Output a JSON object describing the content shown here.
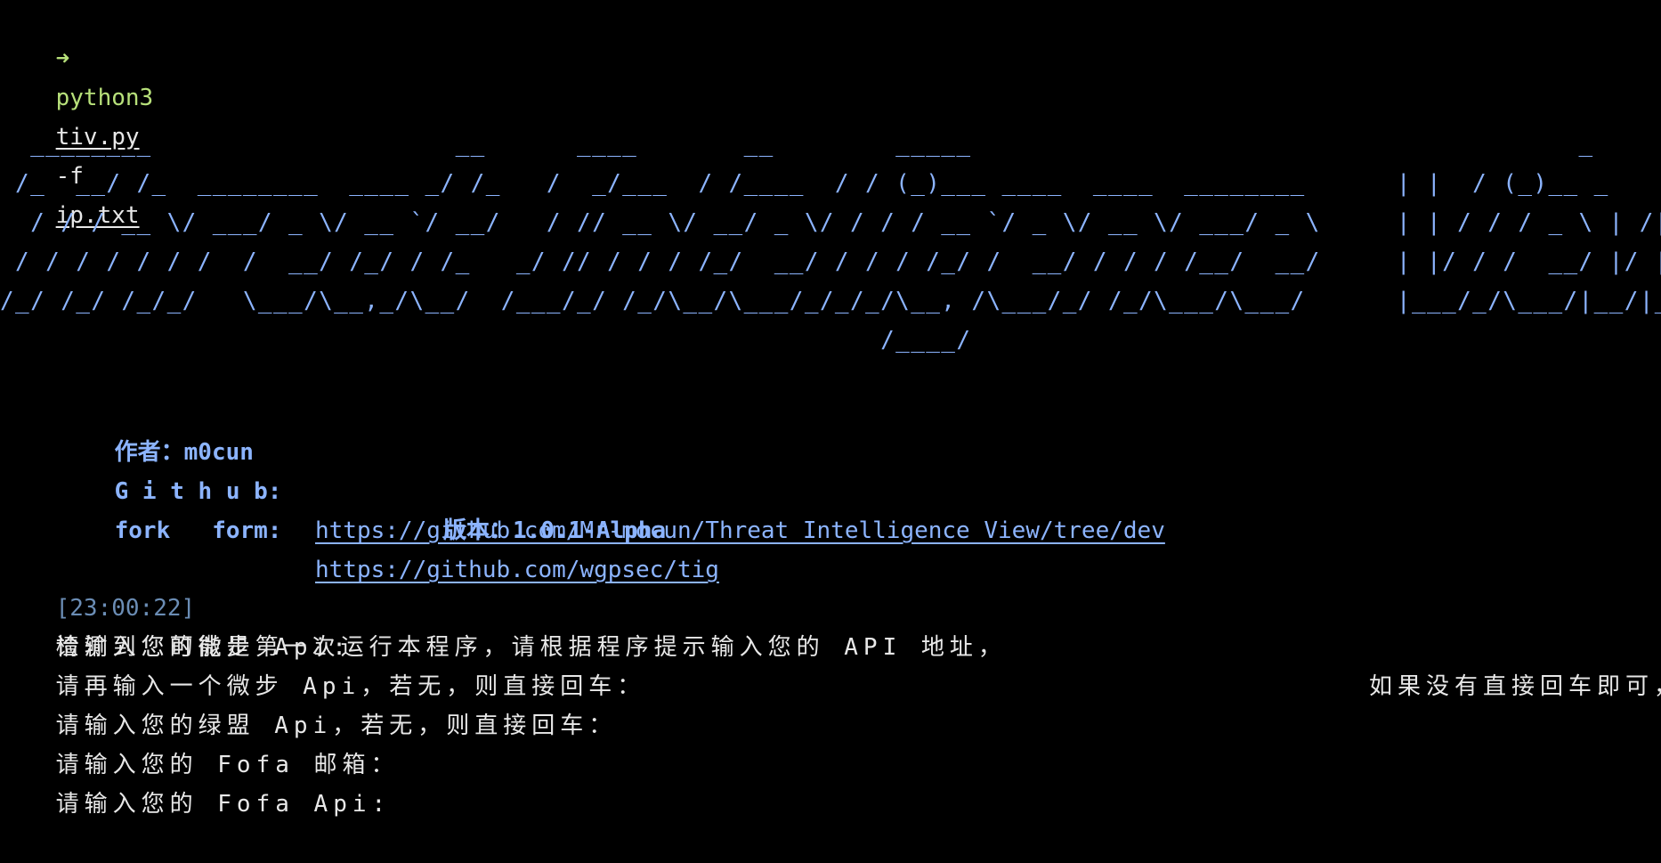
{
  "shell": {
    "arrow": "➜",
    "command": "python3",
    "script": "tiv.py",
    "flag": "-f",
    "input_file": "ip.txt"
  },
  "banner": {
    "ascii_art": "  ________                    __      ____       __        _____                                        _     ___\n /_  __/ /_  ________  ____ _/ /_   /  _/___  / /____  / / (_)___ ____  ____  ________      | |  / (_)__ _      __\n  / / / __ \\/ ___/ _ \\/ __ `/ __/   / // __ \\/ __/ _ \\/ / / / __ `/ _ \\/ __ \\/ ___/ _ \\     | | / / / _ \\ | /| / /\n / / / / / / /  /  __/ /_/ / /_   _/ // / / / /_/  __/ / / / /_/ /  __/ / / / /__/  __/     | |/ / /  __/ |/ |/ /\n/_/ /_/ /_/_/   \\___/\\__,_/\\__/  /___/_/ /_/\\__/\\___/_/_/_/\\__, /\\___/_/ /_/\\___/\\___/      |___/_/\\___/|__/|__/\n                                                          /____/"
  },
  "info": {
    "author_label": "作者：",
    "author_value": "m0cun",
    "version_label": "版本：",
    "version_value": "1.0.1-Alpha",
    "github_label": "G i t h u b:",
    "github_url": "https://github.com/Mr-mocun/Threat_Intelligence_View/tree/dev",
    "fork_label": "fork   form:",
    "fork_url": "https://github.com/wgpsec/tig"
  },
  "log": {
    "timestamp": "[23:00:22]",
    "message": "检测到您可能是第一次运行本程序，请根据程序提示输入您的 API 地址，",
    "message_tail": "如果没有直接回车即可，"
  },
  "prompts": [
    "请输入您的微步 Api:",
    "请再输入一个微步 Api，若无，则直接回车：",
    "请输入您的绿盟 Api，若无，则直接回车：",
    "请输入您的 Fofa 邮箱：",
    "请输入您的 Fofa Api:"
  ],
  "colors": {
    "background": "#000000",
    "prompt_green": "#b7e07a",
    "banner_blue": "#8cb4ff",
    "timestamp": "#6b8db5",
    "text": "#e8e8e8"
  }
}
